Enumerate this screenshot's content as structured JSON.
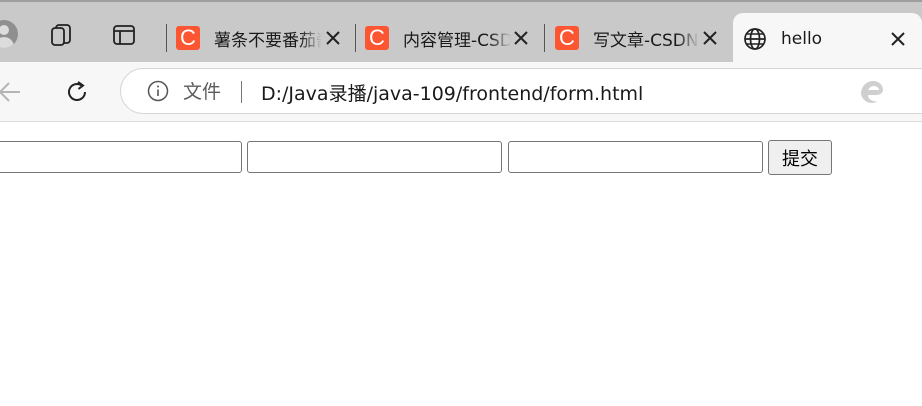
{
  "browser": {
    "tabs": [
      {
        "title": "薯条不要番茄酱",
        "favicon": "csdn-favicon",
        "favicon_letter": "C",
        "active": false
      },
      {
        "title": "内容管理-CSDN",
        "favicon": "csdn-favicon",
        "favicon_letter": "C",
        "active": false
      },
      {
        "title": "写文章-CSDN",
        "favicon": "csdn-favicon",
        "favicon_letter": "C",
        "active": false
      },
      {
        "title": "hello",
        "favicon": "globe-icon",
        "active": true
      }
    ],
    "address_bar": {
      "scheme_label": "文件",
      "url": "D:/Java录播/java-109/frontend/form.html"
    },
    "icons": {
      "profile": "profile-avatar-icon",
      "workspaces": "workspaces-icon",
      "tab_actions": "tab-actions-icon",
      "back": "back-arrow-icon",
      "refresh": "refresh-icon",
      "site_info": "info-icon",
      "edge": "edge-logo-icon",
      "extension": "extension-icon",
      "tab_close": "close-icon"
    },
    "colors": {
      "tabstrip_bg": "#c9c9c9",
      "toolbar_bg": "#f7f7f7",
      "csdn_accent": "#fc5531"
    }
  },
  "form": {
    "inputs": [
      {
        "value": "",
        "placeholder": ""
      },
      {
        "value": "",
        "placeholder": ""
      },
      {
        "value": "",
        "placeholder": ""
      }
    ],
    "submit_label": "提交"
  }
}
